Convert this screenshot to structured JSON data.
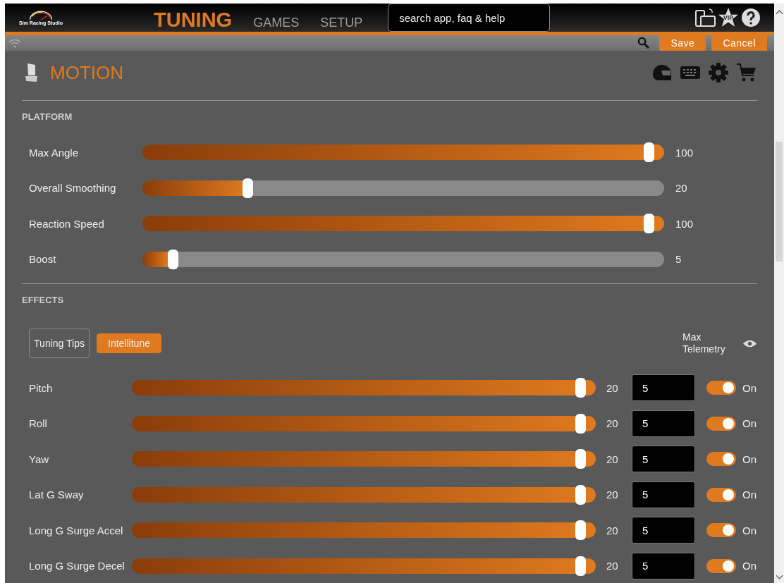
{
  "header": {
    "logo_text": "Sim Racing Studio",
    "tabs": [
      {
        "label": "TUNING",
        "selected": true
      },
      {
        "label": "GAMES",
        "selected": false
      },
      {
        "label": "SETUP",
        "selected": false
      }
    ],
    "search": {
      "placeholder": "search app, faq & help"
    },
    "vip_label": "VIP"
  },
  "toolbar": {
    "buttons": [
      "Save",
      "Cancel"
    ]
  },
  "page": {
    "title": "MOTION"
  },
  "platform": {
    "heading": "PLATFORM",
    "sliders": [
      {
        "name": "Max Angle",
        "level": 1,
        "reading": "100"
      },
      {
        "name": "Overall Smoothing",
        "level": 0.2,
        "reading": "20"
      },
      {
        "name": "Reaction Speed",
        "level": 1,
        "reading": "100"
      },
      {
        "name": "Boost",
        "level": 0.05,
        "reading": "5"
      }
    ]
  },
  "effects": {
    "heading": "EFFECTS",
    "modes": [
      {
        "label": "Tuning Tips",
        "selected": false
      },
      {
        "label": "Intellitune",
        "selected": true
      }
    ],
    "max_telemetry": "Max Telemetry",
    "rows": [
      {
        "name": "Pitch",
        "level": 1,
        "reading": "20",
        "value": "5",
        "on": true,
        "state": "On"
      },
      {
        "name": "Roll",
        "level": 1,
        "reading": "20",
        "value": "5",
        "on": true,
        "state": "On"
      },
      {
        "name": "Yaw",
        "level": 1,
        "reading": "20",
        "value": "5",
        "on": true,
        "state": "On"
      },
      {
        "name": "Lat G Sway",
        "level": 1,
        "reading": "20",
        "value": "5",
        "on": true,
        "state": "On"
      },
      {
        "name": "Long G Surge Accel",
        "level": 1,
        "reading": "20",
        "value": "5",
        "on": true,
        "state": "On"
      },
      {
        "name": "Long G Surge Decel",
        "level": 1,
        "reading": "20",
        "value": "5",
        "on": true,
        "state": "On"
      }
    ]
  }
}
